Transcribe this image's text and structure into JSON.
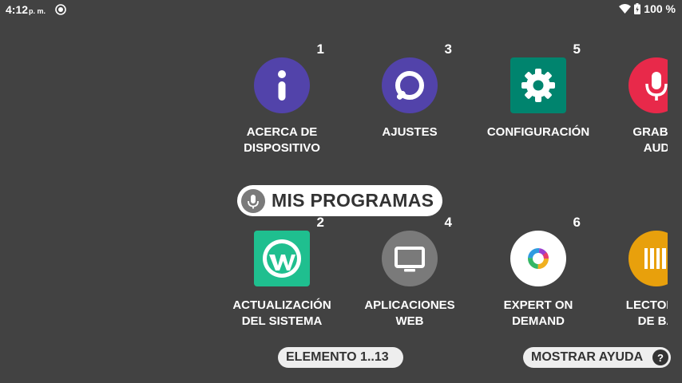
{
  "status_bar": {
    "time": "4:12",
    "ampm": "p. m.",
    "battery": "100 %"
  },
  "apps": {
    "row1": [
      {
        "number": "1",
        "label_line1": "ACERCA DE",
        "label_line2": "DISPOSITIVO",
        "icon": "info-icon",
        "color": "#5243aa"
      },
      {
        "number": "3",
        "label_line1": "AJUSTES",
        "label_line2": "",
        "icon": "wrench-icon",
        "color": "#5243aa"
      },
      {
        "number": "5",
        "label_line1": "CONFIGURACIÓN",
        "label_line2": "",
        "icon": "gear-icon",
        "color": "#00846e"
      },
      {
        "number": "",
        "label_line1": "GRABAI",
        "label_line2": "AUD",
        "icon": "microphone-icon",
        "color": "#e8294a"
      }
    ],
    "row2": [
      {
        "number": "2",
        "label_line1": "ACTUALIZACIÓN",
        "label_line2": "DEL SISTEMA",
        "icon": "wavelink-icon",
        "color": "#1fbf8f"
      },
      {
        "number": "4",
        "label_line1": "APLICACIONES",
        "label_line2": "WEB",
        "icon": "monitor-icon",
        "color": "#7a7a7a"
      },
      {
        "number": "6",
        "label_line1": "EXPERT ON",
        "label_line2": "DEMAND",
        "icon": "expert-ring-icon",
        "color": "#ffffff"
      },
      {
        "number": "",
        "label_line1": "LECTOR D",
        "label_line2": "DE BA",
        "icon": "barcode-icon",
        "color": "#e8a00c"
      }
    ]
  },
  "voice_label": "MIS PROGRAMAS",
  "counter": "ELEMENTO 1..13",
  "help": {
    "label": "MOSTRAR AYUDA",
    "badge": "?"
  }
}
